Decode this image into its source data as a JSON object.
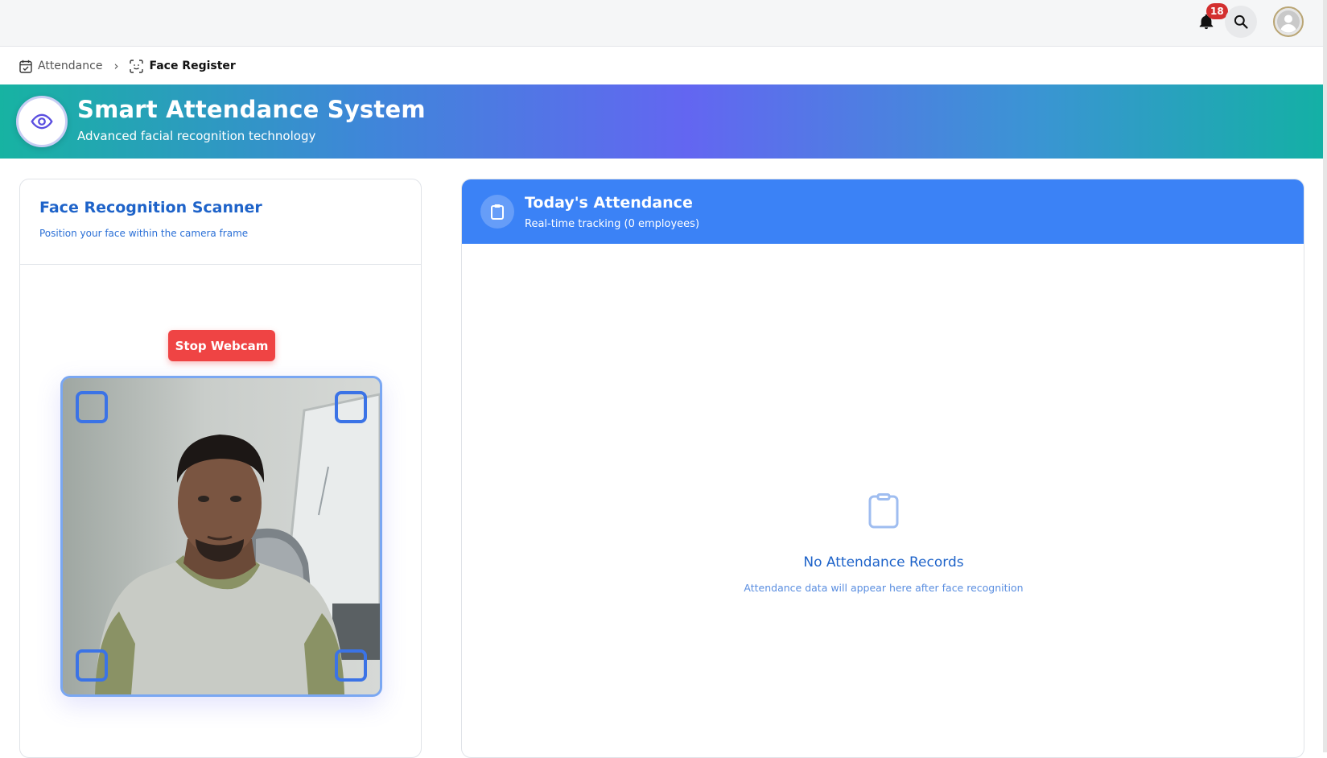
{
  "topbar": {
    "notifications_count": "18",
    "icons": [
      "bell-icon",
      "search-icon",
      "user-avatar-icon"
    ]
  },
  "breadcrumb": {
    "parent": "Attendance",
    "current": "Face Register"
  },
  "hero": {
    "title": "Smart Attendance System",
    "subtitle": "Advanced facial recognition technology",
    "icon": "eye-icon"
  },
  "scanner": {
    "title": "Face Recognition Scanner",
    "subtitle": "Position your face within the camera frame",
    "stop_button": "Stop Webcam"
  },
  "attendance": {
    "title": "Today's Attendance",
    "subtitle": "Real-time tracking (0 employees)",
    "empty_title": "No Attendance Records",
    "empty_subtitle": "Attendance data will appear here after face recognition"
  },
  "colors": {
    "primary_blue": "#3b82f6",
    "danger_red": "#ef4444",
    "heading_blue": "#1e63c9",
    "badge_red": "#d32f2f"
  }
}
